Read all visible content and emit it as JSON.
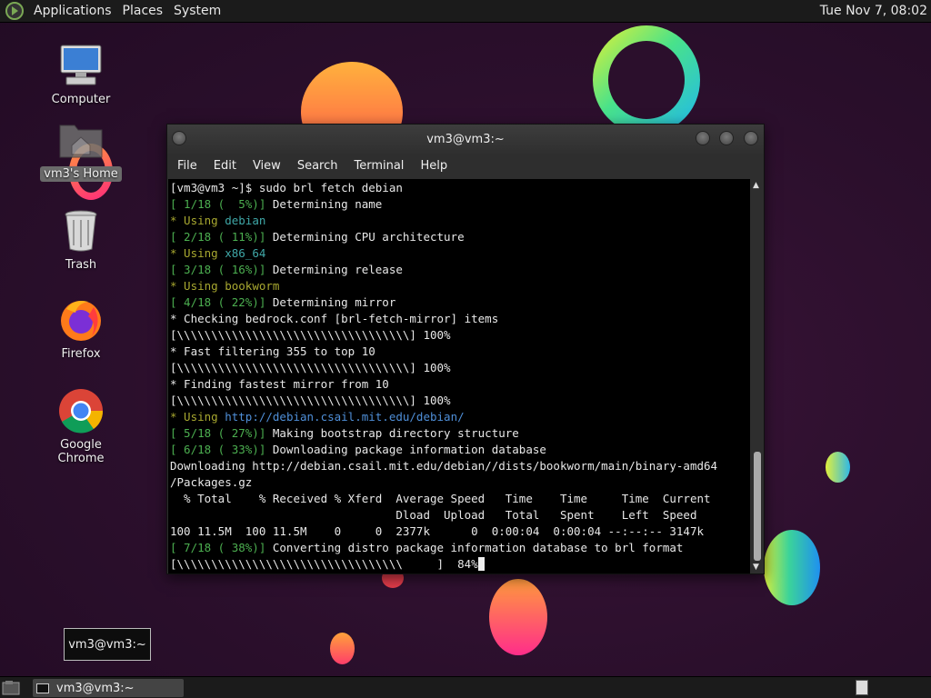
{
  "top_panel": {
    "menus": [
      "Applications",
      "Places",
      "System"
    ],
    "clock": "Tue Nov 7, 08:02"
  },
  "desktop": {
    "icons": [
      {
        "label": "Computer",
        "icon": "computer-icon"
      },
      {
        "label": "vm3's Home",
        "icon": "home-folder-icon"
      },
      {
        "label": "Trash",
        "icon": "trash-icon"
      },
      {
        "label": "Firefox",
        "icon": "firefox-icon"
      },
      {
        "label": "Google Chrome",
        "icon": "chrome-icon"
      }
    ]
  },
  "terminal": {
    "title": "vm3@vm3:~",
    "menu": [
      "File",
      "Edit",
      "View",
      "Search",
      "Terminal",
      "Help"
    ],
    "lines": [
      [
        {
          "t": "[vm3@vm3 ~]$ sudo brl fetch debian"
        }
      ],
      [
        {
          "t": "[ 1/18 (  5%)]",
          "c": "g"
        },
        {
          "t": " Determining name"
        }
      ],
      [
        {
          "t": "* Using ",
          "c": "y"
        },
        {
          "t": "debian",
          "c": "c"
        }
      ],
      [
        {
          "t": "[ 2/18 ( 11%)]",
          "c": "g"
        },
        {
          "t": " Determining CPU architecture"
        }
      ],
      [
        {
          "t": "* Using ",
          "c": "y"
        },
        {
          "t": "x86_64",
          "c": "c"
        }
      ],
      [
        {
          "t": "[ 3/18 ( 16%)]",
          "c": "g"
        },
        {
          "t": " Determining release"
        }
      ],
      [
        {
          "t": "* Using ",
          "c": "y"
        },
        {
          "t": "bookworm",
          "c": "y"
        }
      ],
      [
        {
          "t": "[ 4/18 ( 22%)]",
          "c": "g"
        },
        {
          "t": " Determining mirror"
        }
      ],
      [
        {
          "t": "* Checking bedrock.conf [brl-fetch-mirror] items"
        }
      ],
      [
        {
          "t": "[\\\\\\\\\\\\\\\\\\\\\\\\\\\\\\\\\\\\\\\\\\\\\\\\\\\\\\\\\\\\\\\\\\\\] 100%"
        }
      ],
      [
        {
          "t": "* Fast filtering 355 to top 10"
        }
      ],
      [
        {
          "t": "[\\\\\\\\\\\\\\\\\\\\\\\\\\\\\\\\\\\\\\\\\\\\\\\\\\\\\\\\\\\\\\\\\\\\] 100%"
        }
      ],
      [
        {
          "t": "* Finding fastest mirror from 10"
        }
      ],
      [
        {
          "t": "[\\\\\\\\\\\\\\\\\\\\\\\\\\\\\\\\\\\\\\\\\\\\\\\\\\\\\\\\\\\\\\\\\\\\] 100%"
        }
      ],
      [
        {
          "t": "* Using ",
          "c": "y"
        },
        {
          "t": "http://debian.csail.mit.edu/debian/",
          "c": "b"
        }
      ],
      [
        {
          "t": "[ 5/18 ( 27%)]",
          "c": "g"
        },
        {
          "t": " Making bootstrap directory structure"
        }
      ],
      [
        {
          "t": "[ 6/18 ( 33%)]",
          "c": "g"
        },
        {
          "t": " Downloading package information database"
        }
      ],
      [
        {
          "t": "Downloading http://debian.csail.mit.edu/debian//dists/bookworm/main/binary-amd64"
        }
      ],
      [
        {
          "t": "/Packages.gz"
        }
      ],
      [
        {
          "t": "  % Total    % Received % Xferd  Average Speed   Time    Time     Time  Current"
        }
      ],
      [
        {
          "t": "                                 Dload  Upload   Total   Spent    Left  Speed"
        }
      ],
      [
        {
          "t": "100 11.5M  100 11.5M    0     0  2377k      0  0:00:04  0:00:04 --:--:-- 3147k"
        }
      ],
      [
        {
          "t": "[ 7/18 ( 38%)]",
          "c": "g"
        },
        {
          "t": " Converting distro package information database to brl format"
        }
      ],
      [
        {
          "t": "[\\\\\\\\\\\\\\\\\\\\\\\\\\\\\\\\\\\\\\\\\\\\\\\\\\\\\\\\\\\\\\\\\\     ]  84%"
        },
        {
          "t": " ",
          "c": "cursor"
        }
      ]
    ]
  },
  "notice": {
    "text": "vm3@vm3:~"
  },
  "taskbar": {
    "task_label": "vm3@vm3:~"
  }
}
